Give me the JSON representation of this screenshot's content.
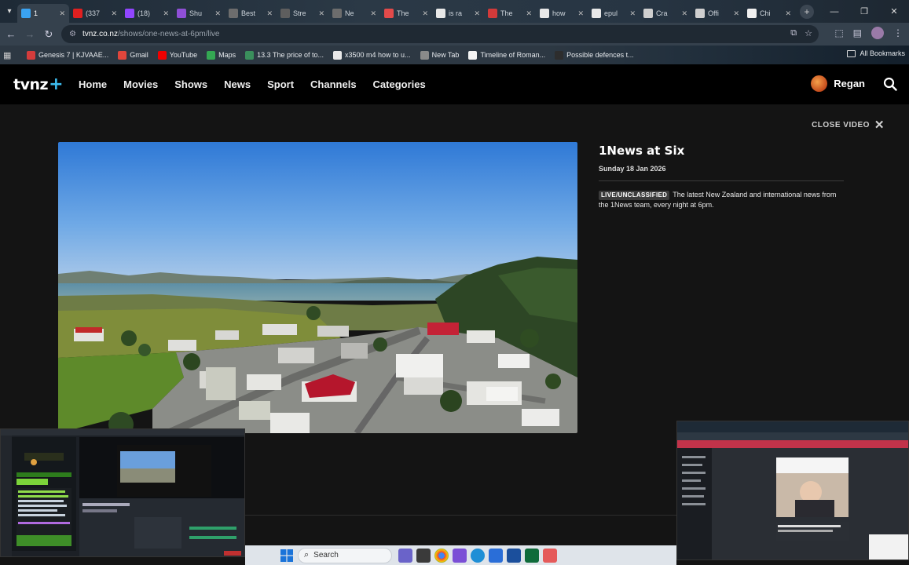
{
  "browser": {
    "tabs": [
      {
        "label": "1",
        "color": "#3aa3f2",
        "active": true
      },
      {
        "label": "(337",
        "color": "#e02020",
        "active": false
      },
      {
        "label": "(18)",
        "color": "#9146ff",
        "active": false
      },
      {
        "label": "Shu",
        "color": "#8f4fd6",
        "active": false
      },
      {
        "label": "Best",
        "color": "#6d6d6d",
        "active": false
      },
      {
        "label": "Stre",
        "color": "#5e5e5e",
        "active": false
      },
      {
        "label": "Ne",
        "color": "#6d6d6d",
        "active": false
      },
      {
        "label": "The",
        "color": "#e34a4a",
        "active": false
      },
      {
        "label": "is ra",
        "color": "#e8e8e8",
        "active": false
      },
      {
        "label": "The",
        "color": "#d23a3a",
        "active": false
      },
      {
        "label": "how",
        "color": "#e8e8e8",
        "active": false
      },
      {
        "label": "epul",
        "color": "#e8e8e8",
        "active": false
      },
      {
        "label": "Cra",
        "color": "#cfcfcf",
        "active": false
      },
      {
        "label": "Offi",
        "color": "#cfcfcf",
        "active": false
      },
      {
        "label": "Chi",
        "color": "#f0f0f0",
        "active": false
      }
    ],
    "url_host": "tvnz.co.nz",
    "url_path": "/shows/one-news-at-6pm/live",
    "bookmarks": [
      {
        "label": "Genesis 7 | KJVAAE...",
        "color": "#d43c3c"
      },
      {
        "label": "Gmail",
        "color": "#e0463c"
      },
      {
        "label": "YouTube",
        "color": "#f00000"
      },
      {
        "label": "Maps",
        "color": "#34a853"
      },
      {
        "label": "13.3 The price of to...",
        "color": "#3a8f5c"
      },
      {
        "label": "x3500 m4 how to u...",
        "color": "#e8e8e8"
      },
      {
        "label": "New Tab",
        "color": "#8a8a8a"
      },
      {
        "label": "Timeline of Roman...",
        "color": "#f4f4f4"
      },
      {
        "label": "Possible defences t...",
        "color": "#2d2d2d"
      }
    ],
    "all_bookmarks": "All Bookmarks"
  },
  "site": {
    "logo_text": "tvnz",
    "logo_plus": "+",
    "nav": [
      "Home",
      "Movies",
      "Shows",
      "News",
      "Sport",
      "Channels",
      "Categories"
    ],
    "user_name": "Regan",
    "close_video": "CLOSE VIDEO"
  },
  "show": {
    "title": "1News at Six",
    "date": "Sunday 18 Jan 2026",
    "badge": "LIVE/UNCLASSIFIED",
    "description": "The latest New Zealand and international news from the 1News team, every night at 6pm."
  },
  "taskbar": {
    "search_label": "Search"
  },
  "colors": {
    "accent_plus": "#3dbdf0",
    "site_bg": "#141414",
    "header_bg": "#000000"
  }
}
